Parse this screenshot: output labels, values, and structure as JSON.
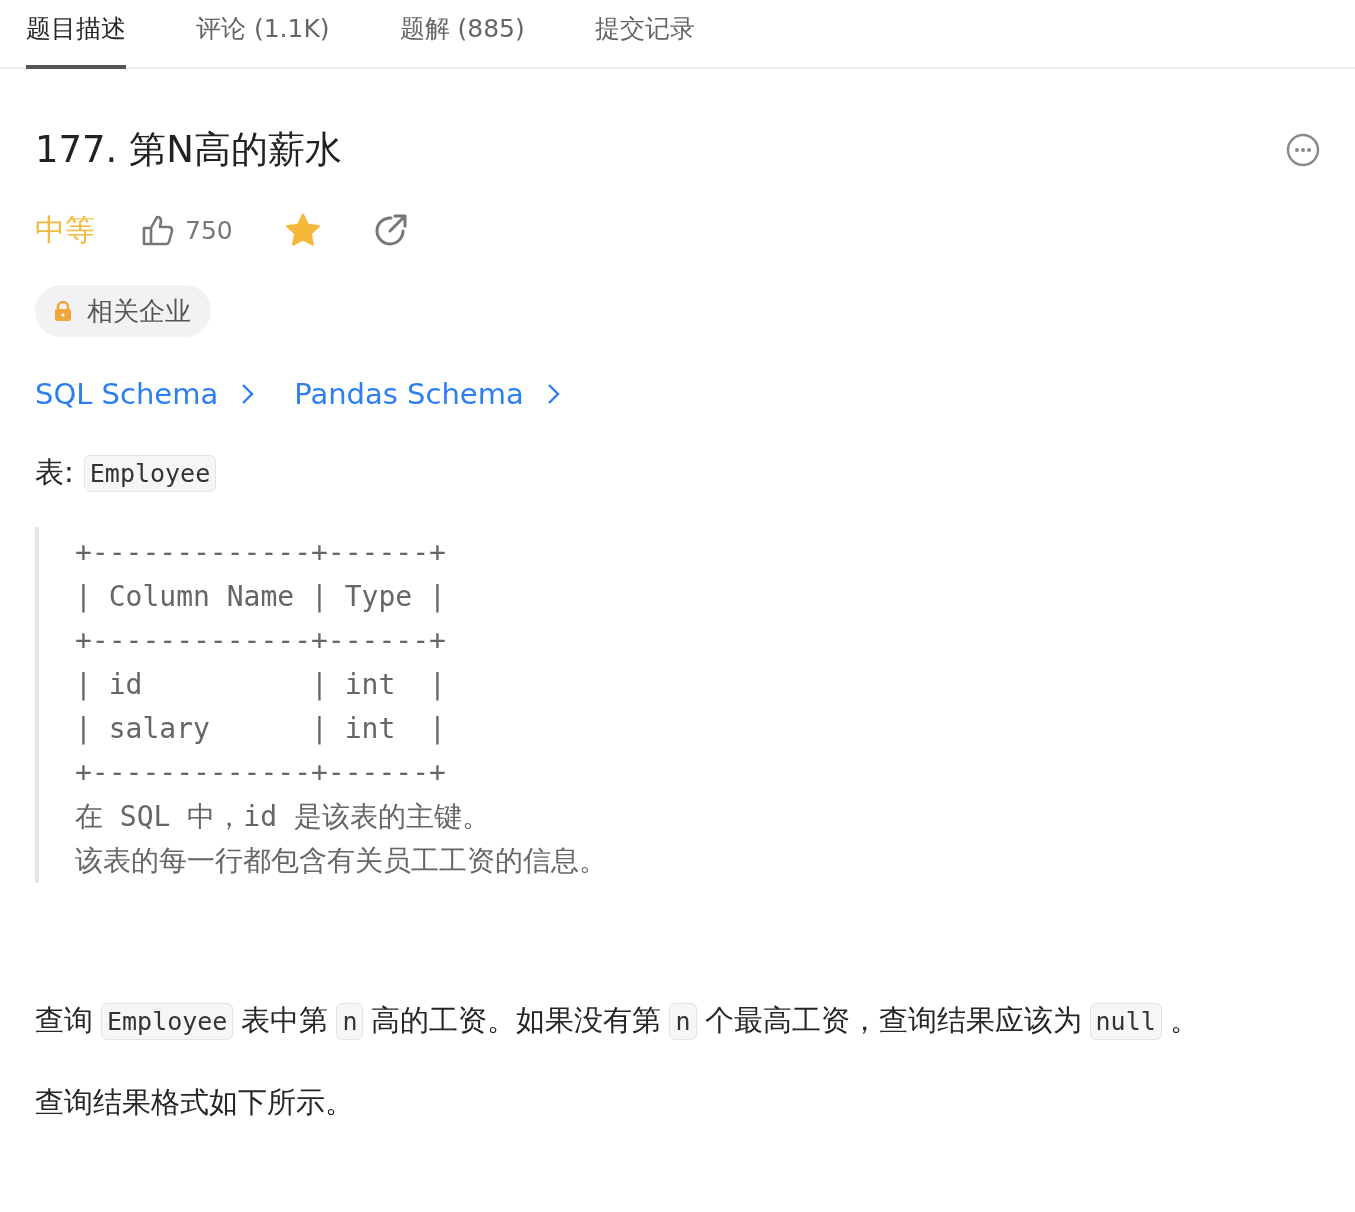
{
  "tabs": [
    {
      "label": "题目描述",
      "selected": true
    },
    {
      "label": "评论 (1.1K)",
      "selected": false
    },
    {
      "label": "题解 (885)",
      "selected": false
    },
    {
      "label": "提交记录",
      "selected": false
    }
  ],
  "title": "177. 第N高的薪水",
  "difficulty": "中等",
  "likes": "750",
  "favorited": true,
  "companies_tag": "相关企业",
  "schema_links": [
    "SQL Schema",
    "Pandas Schema"
  ],
  "table_label": {
    "prefix": "表:",
    "name": "Employee"
  },
  "schema_block": [
    "+-------------+------+",
    "| Column Name | Type |",
    "+-------------+------+",
    "| id          | int  |",
    "| salary      | int  |",
    "+-------------+------+",
    "在 SQL 中，id 是该表的主键。",
    "该表的每一行都包含有关员工工资的信息。"
  ],
  "paragraphs": [
    [
      {
        "kind": "text",
        "text": "查询"
      },
      {
        "kind": "code",
        "text": "Employee"
      },
      {
        "kind": "text",
        "text": "表中第"
      },
      {
        "kind": "code",
        "text": "n"
      },
      {
        "kind": "text",
        "text": "高的工资。如果没有第"
      },
      {
        "kind": "code",
        "text": "n"
      },
      {
        "kind": "text",
        "text": "个最高工资，查询结果应该为"
      },
      {
        "kind": "code",
        "text": "null"
      },
      {
        "kind": "text",
        "text": "。"
      }
    ],
    [
      {
        "kind": "text",
        "text": "查询结果格式如下所示。"
      }
    ]
  ]
}
